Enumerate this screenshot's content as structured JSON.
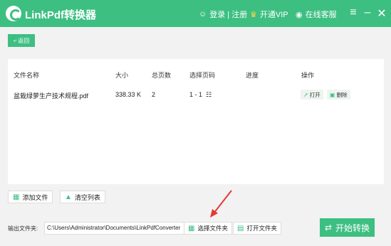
{
  "app": {
    "title": "LinkPdf转换器"
  },
  "header": {
    "login": "登录 | 注册",
    "vip": "开通VIP",
    "service": "在线客服"
  },
  "toolbar": {
    "back_label": "返回"
  },
  "table": {
    "columns": [
      "文件名称",
      "大小",
      "总页数",
      "选择页码",
      "进度",
      "操作"
    ],
    "rows": [
      {
        "name": "盆栽绿萝生产技术规程.pdf",
        "size": "338.33 K",
        "pages": "2",
        "range": "1 - 1",
        "progress": "",
        "open": "打开",
        "delete": "删除"
      }
    ]
  },
  "actions": {
    "add_file": "添加文件",
    "clear_list": "清空列表"
  },
  "output": {
    "label": "输出文件夹:",
    "path": "C:\\Users\\Administrator\\Documents\\LinkPdfConverter",
    "choose_folder": "选择文件夹",
    "open_folder": "打开文件夹"
  },
  "start_label": "开始转换",
  "colors": {
    "accent": "#3dbf82",
    "arrow": "#e53935"
  }
}
